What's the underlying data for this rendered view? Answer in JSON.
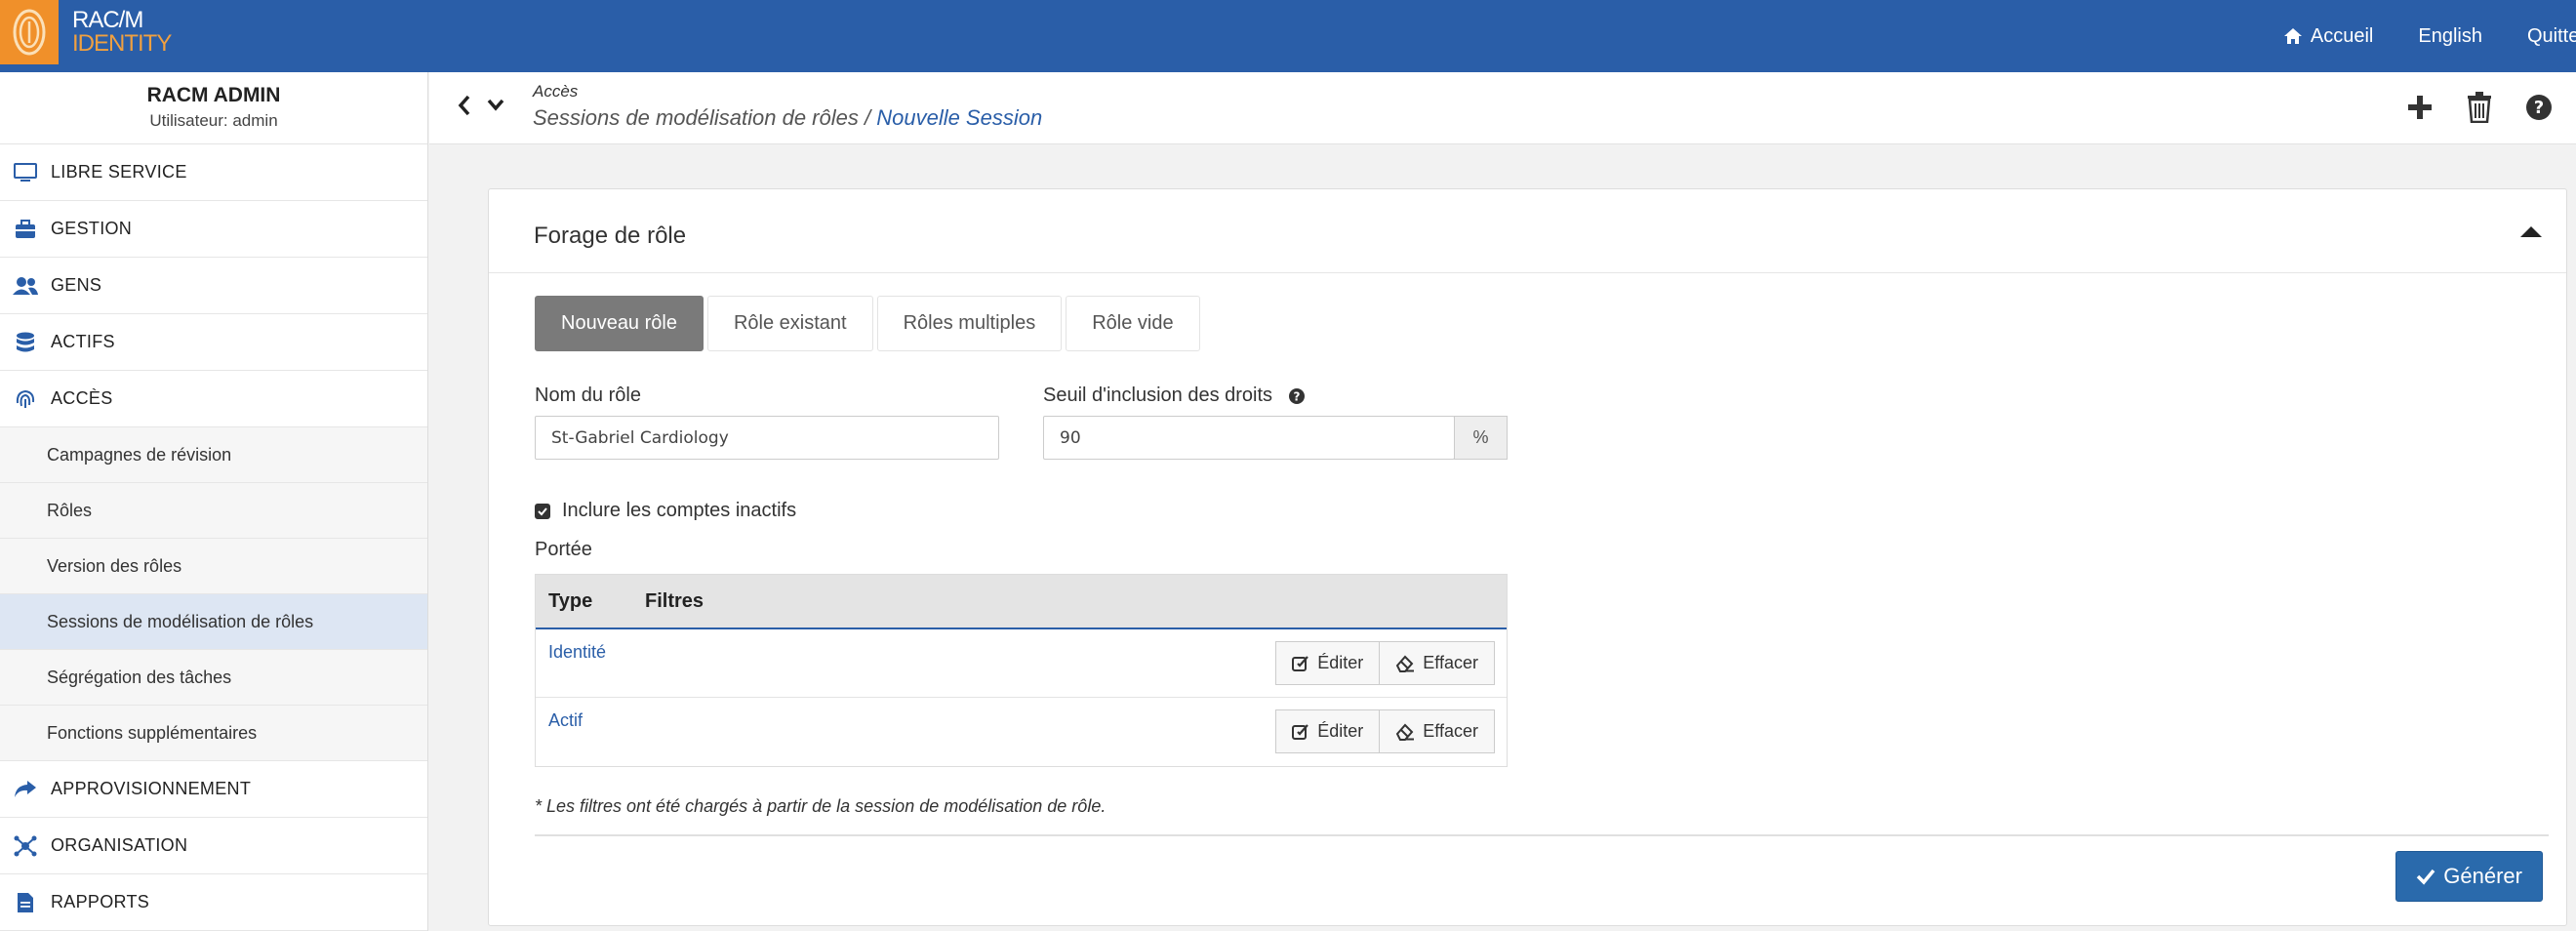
{
  "topbar": {
    "logo_line1": "RAC/M",
    "logo_line2": "IDENTITY",
    "nav": {
      "home": "Accueil",
      "language": "English",
      "quit": "Quitter"
    }
  },
  "sidebar": {
    "admin_name": "RACM ADMIN",
    "user_label": "Utilisateur: admin",
    "menu": [
      {
        "label": "LIBRE SERVICE",
        "icon": "monitor-icon"
      },
      {
        "label": "GESTION",
        "icon": "briefcase-icon"
      },
      {
        "label": "GENS",
        "icon": "people-icon"
      },
      {
        "label": "ACTIFS",
        "icon": "database-icon"
      },
      {
        "label": "ACCÈS",
        "icon": "fingerprint-icon"
      }
    ],
    "submenu": [
      "Campagnes de révision",
      "Rôles",
      "Version des rôles",
      "Sessions de modélisation de rôles",
      "Ségrégation des tâches",
      "Fonctions supplémentaires"
    ],
    "menu_after": [
      {
        "label": "APPROVISIONNEMENT",
        "icon": "share-icon"
      },
      {
        "label": "ORGANISATION",
        "icon": "network-icon"
      },
      {
        "label": "RAPPORTS",
        "icon": "document-icon"
      }
    ]
  },
  "header": {
    "section": "Accès",
    "path": "Sessions de modélisation de rôles /",
    "current": "Nouvelle Session"
  },
  "card": {
    "title": "Forage de rôle",
    "tabs": [
      "Nouveau rôle",
      "Rôle existant",
      "Rôles multiples",
      "Rôle vide"
    ],
    "role_name_label": "Nom du rôle",
    "role_name_value": "St-Gabriel Cardiology",
    "threshold_label": "Seuil d'inclusion des droits",
    "threshold_value": "90",
    "threshold_unit": "%",
    "include_inactive_label": "Inclure les comptes inactifs",
    "scope_label": "Portée",
    "scope_columns": [
      "Type",
      "Filtres"
    ],
    "scope_rows": [
      {
        "type": "Identité",
        "edit": "Éditer",
        "clear": "Effacer"
      },
      {
        "type": "Actif",
        "edit": "Éditer",
        "clear": "Effacer"
      }
    ],
    "note": "* Les filtres ont été chargés à partir de la session de modélisation de rôle.",
    "generate_label": "Générer"
  },
  "colors": {
    "topbar": "#2a5ea8",
    "brand_orange": "#f0902a",
    "active_tab": "#7a7a7a",
    "primary_button": "#2a6aac"
  }
}
